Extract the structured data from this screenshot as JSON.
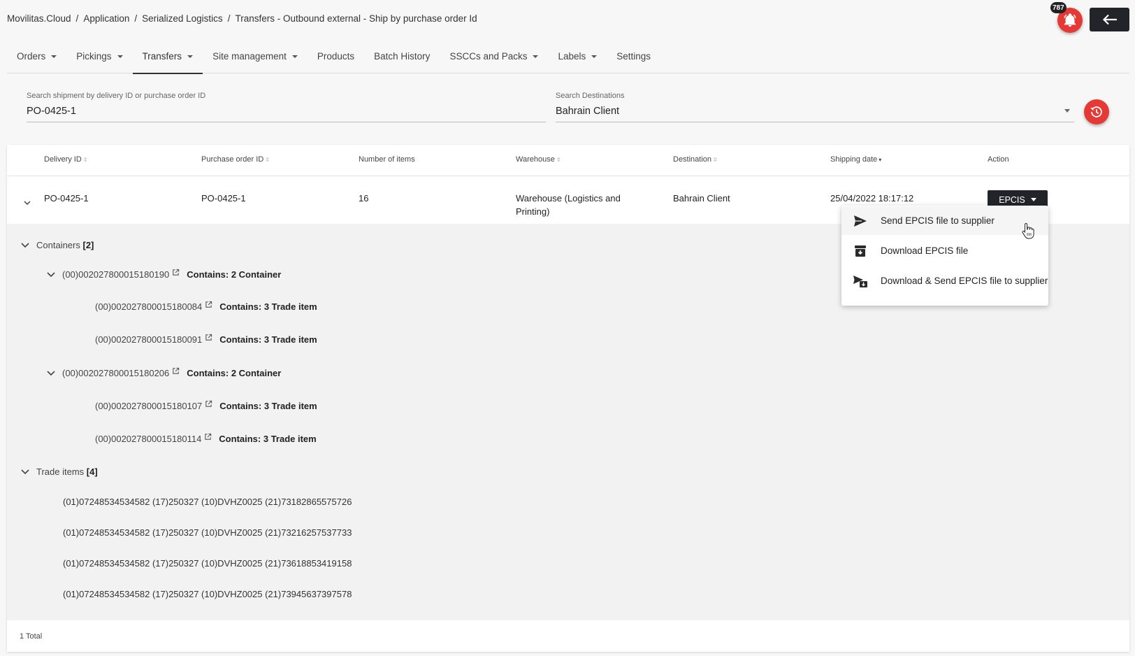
{
  "breadcrumb": [
    "Movilitas.Cloud",
    "Application",
    "Serialized Logistics",
    "Transfers - Outbound external - Ship by purchase order Id"
  ],
  "notification": {
    "count": "787",
    "icon": "bell-icon"
  },
  "back_button": {
    "icon": "arrow-left-icon"
  },
  "tabs": [
    {
      "label": "Orders",
      "dropdown": true
    },
    {
      "label": "Pickings",
      "dropdown": true
    },
    {
      "label": "Transfers",
      "dropdown": true,
      "active": true
    },
    {
      "label": "Site management",
      "dropdown": true
    },
    {
      "label": "Products",
      "dropdown": false
    },
    {
      "label": "Batch History",
      "dropdown": false
    },
    {
      "label": "SSCCs and Packs",
      "dropdown": true
    },
    {
      "label": "Labels",
      "dropdown": true
    },
    {
      "label": "Settings",
      "dropdown": false
    }
  ],
  "search": {
    "shipment_label": "Search shipment by delivery ID or purchase order ID",
    "shipment_value": "PO-0425-1",
    "destination_label": "Search Destinations",
    "destination_value": "Bahrain Client"
  },
  "table": {
    "headers": {
      "delivery_id": "Delivery ID",
      "purchase_order_id": "Purchase order ID",
      "number_of_items": "Number of items",
      "warehouse": "Warehouse",
      "destination": "Destination",
      "shipping_date": "Shipping date",
      "action": "Action"
    },
    "row": {
      "delivery_id": "PO-0425-1",
      "purchase_order_id": "PO-0425-1",
      "number_of_items": "16",
      "warehouse_line1": "Warehouse (Logistics and",
      "warehouse_line2": "Printing)",
      "destination": "Bahrain Client",
      "shipping_date": "25/04/2022 18:17:12",
      "action_label": "EPCIS"
    },
    "footer": "1 Total"
  },
  "details": {
    "containers_label": "Containers",
    "containers_count": "[2]",
    "containers": [
      {
        "id": "(00)002027800015180190",
        "contains": "Contains: 2 Container",
        "children": [
          {
            "id": "(00)002027800015180084",
            "contains": "Contains: 3 Trade item"
          },
          {
            "id": "(00)002027800015180091",
            "contains": "Contains: 3 Trade item"
          }
        ]
      },
      {
        "id": "(00)002027800015180206",
        "contains": "Contains: 2 Container",
        "children": [
          {
            "id": "(00)002027800015180107",
            "contains": "Contains: 3 Trade item"
          },
          {
            "id": "(00)002027800015180114",
            "contains": "Contains: 3 Trade item"
          }
        ]
      }
    ],
    "trade_items_label": "Trade items",
    "trade_items_count": "[4]",
    "trade_items": [
      "(01)07248534534582 (17)250327 (10)DVHZ0025 (21)73182865575726",
      "(01)07248534534582 (17)250327 (10)DVHZ0025 (21)73216257537733",
      "(01)07248534534582 (17)250327 (10)DVHZ0025 (21)73618853419158",
      "(01)07248534534582 (17)250327 (10)DVHZ0025 (21)73945637397578"
    ]
  },
  "epcis_menu": [
    {
      "label": "Send EPCIS file to supplier",
      "icon": "send-icon"
    },
    {
      "label": "Download EPCIS file",
      "icon": "archive-download-icon"
    },
    {
      "label": "Download & Send EPCIS file to supplier",
      "icon": "send-download-icon"
    }
  ],
  "colors": {
    "accent_red": "#e53935",
    "dark_button": "#212529"
  }
}
